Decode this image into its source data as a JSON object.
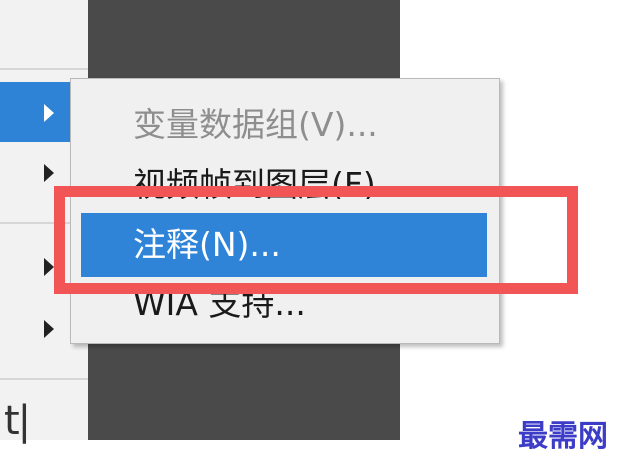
{
  "parent_menu": {
    "trunc_text": "t|"
  },
  "submenu": {
    "items": [
      {
        "label": "变量数据组(V)...",
        "state": "disabled"
      },
      {
        "label": "视频帧到图层(F)...",
        "state": "normal"
      },
      {
        "label": "注释(N)...",
        "state": "selected"
      },
      {
        "label": "WIA 支持...",
        "state": "normal"
      }
    ]
  },
  "colors": {
    "highlight": "#2f84d8",
    "annotation_box": "#f25555",
    "dark_area": "#4a4a4a"
  },
  "icons": [
    "submenu-arrow-icon"
  ],
  "watermark": "最需网"
}
